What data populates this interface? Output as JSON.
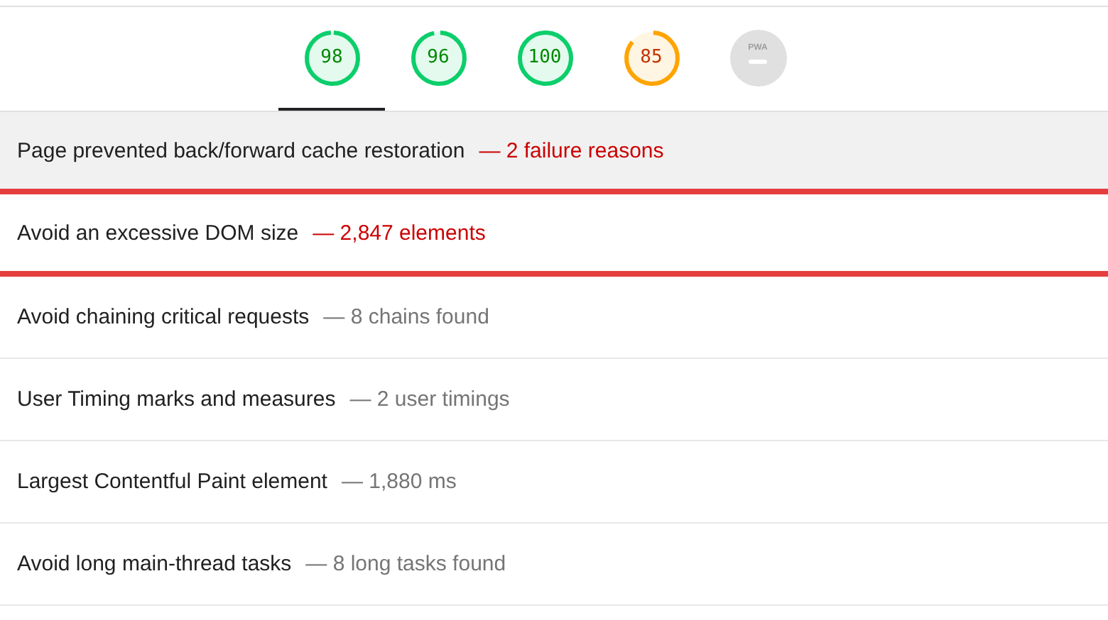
{
  "gauges": [
    {
      "kind": "score",
      "label": "98",
      "level": 0.98,
      "color": "#0cce6b",
      "selected": true
    },
    {
      "kind": "score",
      "label": "96",
      "level": 0.96,
      "color": "#0cce6b",
      "selected": false
    },
    {
      "kind": "score",
      "label": "100",
      "level": 1,
      "color": "#0cce6b",
      "selected": false
    },
    {
      "kind": "score",
      "label": "85",
      "level": 0.85,
      "color": "#ffa400",
      "selected": false
    },
    {
      "kind": "pwa",
      "label": "PWA",
      "selected": false
    }
  ],
  "audits": [
    {
      "title": "Page prevented back/forward cache restoration",
      "detail": "— 2 failure reasons",
      "flagged": true,
      "selected": true
    },
    {
      "title": "Avoid an excessive DOM size",
      "detail": "— 2,847 elements",
      "flagged": true,
      "selected": false
    },
    {
      "title": "Avoid chaining critical requests",
      "detail": "— 8 chains found",
      "flagged": false,
      "selected": false
    },
    {
      "title": "User Timing marks and measures",
      "detail": "— 2 user timings",
      "flagged": false,
      "selected": false
    },
    {
      "title": "Largest Contentful Paint element",
      "detail": "— 1,880 ms",
      "flagged": false,
      "selected": false
    },
    {
      "title": "Avoid long main-thread tasks",
      "detail": "— 8 long tasks found",
      "flagged": false,
      "selected": false
    }
  ]
}
